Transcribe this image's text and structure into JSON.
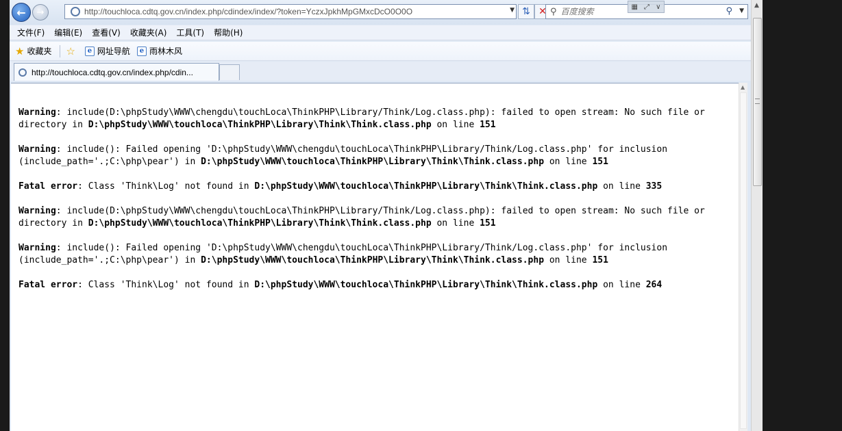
{
  "browser": {
    "address_url": "http://touchloca.cdtq.gov.cn/index.php/cdindex/index/?token=YczxJpkhMpGMxcDcO0O0O",
    "search_placeholder": "百度搜索"
  },
  "menubar": {
    "items": [
      "文件(F)",
      "编辑(E)",
      "查看(V)",
      "收藏夹(A)",
      "工具(T)",
      "帮助(H)"
    ]
  },
  "favorites": {
    "favorites_label": "收藏夹",
    "links": [
      "网址导航",
      "雨林木风"
    ]
  },
  "tabs": {
    "active_title": "http://touchloca.cdtq.gov.cn/index.php/cdin..."
  },
  "errors": [
    {
      "label": "Warning",
      "message": ": include(D:\\phpStudy\\WWW\\chengdu\\touchLoca\\ThinkPHP\\Library/Think/Log.class.php): failed to open stream: No such file or directory in ",
      "file": "D:\\phpStudy\\WWW\\touchloca\\ThinkPHP\\Library\\Think\\Think.class.php",
      "on_line": " on line ",
      "line": "151"
    },
    {
      "label": "Warning",
      "message": ": include(): Failed opening 'D:\\phpStudy\\WWW\\chengdu\\touchLoca\\ThinkPHP\\Library/Think/Log.class.php' for inclusion (include_path='.;C:\\php\\pear') in ",
      "file": "D:\\phpStudy\\WWW\\touchloca\\ThinkPHP\\Library\\Think\\Think.class.php",
      "on_line": " on line ",
      "line": "151"
    },
    {
      "label": "Fatal error",
      "message": ": Class 'Think\\Log' not found in ",
      "file": "D:\\phpStudy\\WWW\\touchloca\\ThinkPHP\\Library\\Think\\Think.class.php",
      "on_line": " on line ",
      "line": "335"
    },
    {
      "label": "Warning",
      "message": ": include(D:\\phpStudy\\WWW\\chengdu\\touchLoca\\ThinkPHP\\Library/Think/Log.class.php): failed to open stream: No such file or directory in ",
      "file": "D:\\phpStudy\\WWW\\touchloca\\ThinkPHP\\Library\\Think\\Think.class.php",
      "on_line": " on line ",
      "line": "151"
    },
    {
      "label": "Warning",
      "message": ": include(): Failed opening 'D:\\phpStudy\\WWW\\chengdu\\touchLoca\\ThinkPHP\\Library/Think/Log.class.php' for inclusion (include_path='.;C:\\php\\pear') in ",
      "file": "D:\\phpStudy\\WWW\\touchloca\\ThinkPHP\\Library\\Think\\Think.class.php",
      "on_line": " on line ",
      "line": "151"
    },
    {
      "label": "Fatal error",
      "message": ": Class 'Think\\Log' not found in ",
      "file": "D:\\phpStudy\\WWW\\touchloca\\ThinkPHP\\Library\\Think\\Think.class.php",
      "on_line": " on line ",
      "line": "264"
    }
  ],
  "icons": {
    "back": "back-arrow-icon",
    "forward": "forward-arrow-icon",
    "refresh": "refresh-icon",
    "stop": "stop-icon",
    "search": "search-icon"
  },
  "colors": {
    "chrome_bg": "#dfe8f4",
    "back_button": "#1f5fbf",
    "stop_red": "#d42020"
  }
}
